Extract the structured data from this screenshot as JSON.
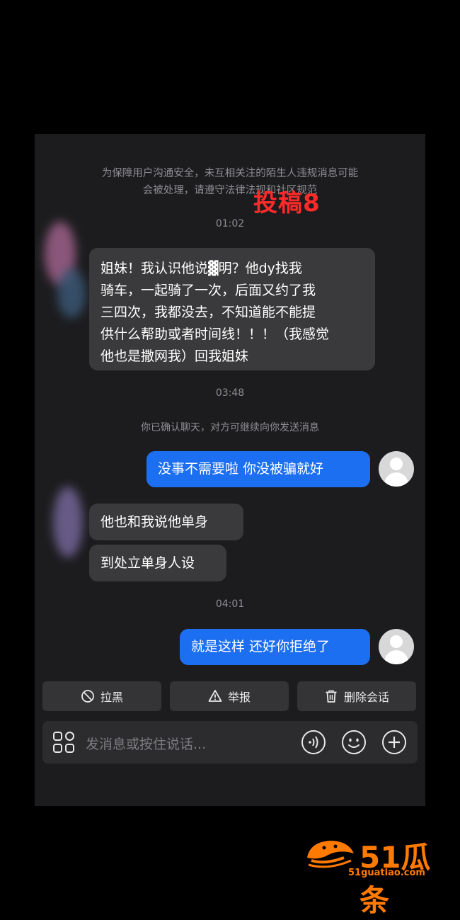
{
  "notice": {
    "line1": "为保障用户沟通安全，未互相关注的陌生人违规消息可能",
    "line2": "会被处理，请遵守法律法规和社区规范"
  },
  "stamp": "投稿8",
  "messages": {
    "time1": "01:02",
    "in1": [
      "姐妹！我认识他说▓明？他dy找我",
      "骑车，一起骑了一次，后面又约了我",
      "三四次，我都没去，不知道能不能提",
      "供什么帮助或者时间线！！！（我感觉",
      "他也是撒网我）回我姐妹"
    ],
    "time2": "03:48",
    "system": "你已确认聊天，对方可继续向你发送消息",
    "out1": "没事不需要啦 你没被骗就好",
    "in2": "他也和我说他单身",
    "in3": "到处立单身人设",
    "time3": "04:01",
    "out2": "就是这样 还好你拒绝了"
  },
  "actions": {
    "block": "拉黑",
    "report": "举报",
    "delete": "删除会话"
  },
  "input": {
    "placeholder": "发消息或按住说话..."
  },
  "watermark": {
    "text": "51瓜条",
    "url": "51guatiao.com"
  },
  "colors": {
    "background": "#1c1c1e",
    "incoming": "#3a3a3c",
    "outgoing": "#1d6ff2",
    "stamp": "#ff2a2a",
    "watermark": "#ff7a00"
  }
}
